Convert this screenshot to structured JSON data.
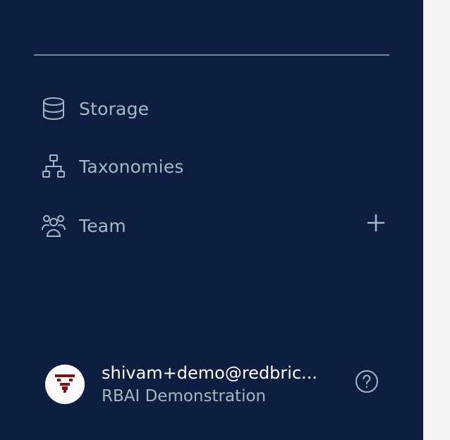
{
  "sidebar": {
    "items": [
      {
        "label": "Storage",
        "icon": "database-icon"
      },
      {
        "label": "Taxonomies",
        "icon": "hierarchy-icon"
      },
      {
        "label": "Team",
        "icon": "users-icon"
      }
    ],
    "team_add_icon": "plus-icon"
  },
  "user": {
    "email": "shivam+demo@redbric...",
    "organization": "RBAI Demonstration",
    "avatar_icon": "logo-avatar"
  },
  "help": {
    "icon": "question-circle-icon"
  },
  "colors": {
    "sidebar_bg": "#0d1e40",
    "nav_text": "#a9b4c6",
    "email_text": "#ffffff",
    "right_panel_bg": "#f4f4f5",
    "avatar_mark": "#7b1616"
  }
}
